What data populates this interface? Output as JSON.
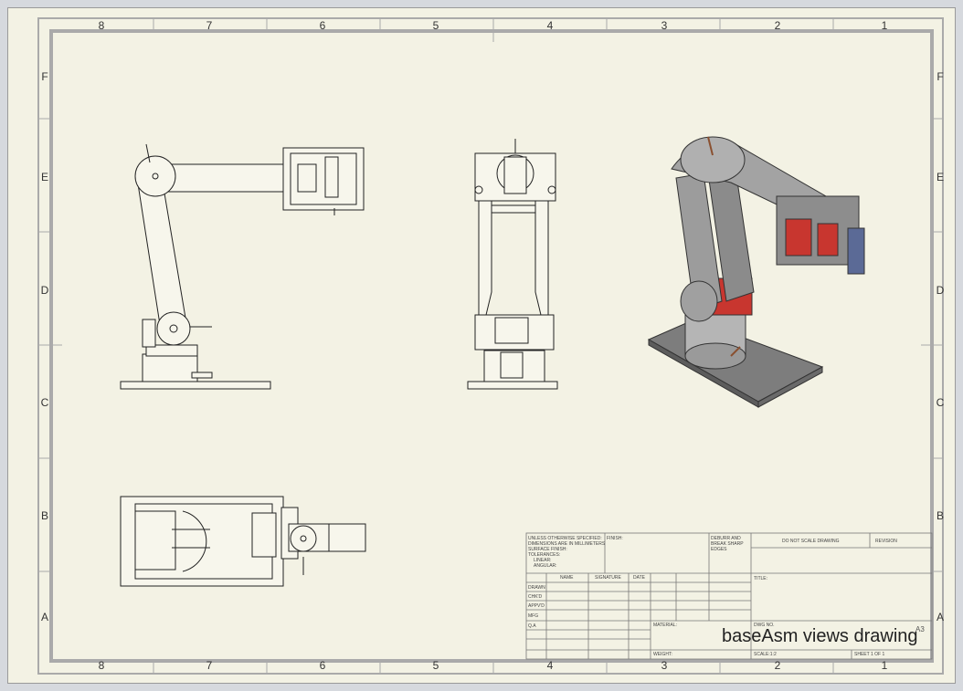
{
  "sheet": {
    "columns": [
      "8",
      "7",
      "6",
      "5",
      "4",
      "3",
      "2",
      "1"
    ],
    "rows": [
      "F",
      "E",
      "D",
      "C",
      "B",
      "A"
    ]
  },
  "title_block": {
    "tolerance_note": [
      "UNLESS OTHERWISE SPECIFIED:",
      "DIMENSIONS ARE IN MILLIMETERS",
      "SURFACE FINISH:",
      "TOLERANCES:",
      "LINEAR:",
      "ANGULAR:"
    ],
    "finish": "FINISH:",
    "deburr": [
      "DEBURR AND",
      "BREAK SHARP",
      "EDGES"
    ],
    "do_not_scale": "DO NOT SCALE DRAWING",
    "revision": "REVISION",
    "headers": [
      "NAME",
      "SIGNATURE",
      "DATE"
    ],
    "roles": [
      "DRAWN",
      "CHK'D",
      "APPV'D",
      "MFG",
      "Q.A"
    ],
    "title_label": "TITLE:",
    "material": "MATERIAL:",
    "dwg_no": "DWG NO.",
    "drawing_name": "baseAsm views drawing",
    "size": "A3",
    "weight": "WEIGHT:",
    "scale": "SCALE:1:2",
    "sheet": "SHEET 1 OF 1"
  }
}
